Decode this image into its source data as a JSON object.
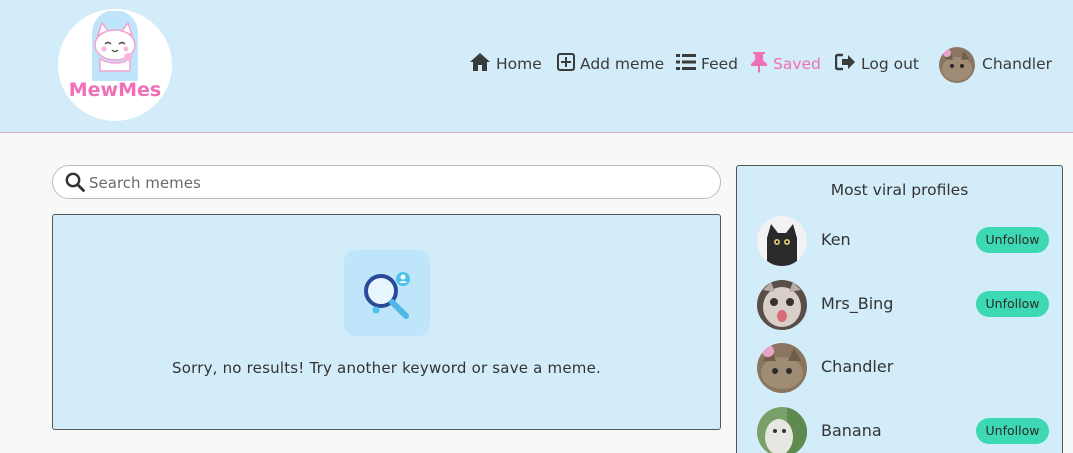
{
  "app": {
    "logo_text": "MewMes"
  },
  "nav": {
    "home": "Home",
    "add_meme": "Add meme",
    "feed": "Feed",
    "saved": "Saved",
    "logout": "Log out",
    "user": "Chandler"
  },
  "search": {
    "placeholder": "Search memes",
    "value": ""
  },
  "results": {
    "empty_message": "Sorry, no results! Try another keyword or save a meme."
  },
  "viral": {
    "title": "Most viral profiles",
    "profiles": [
      {
        "name": "Ken",
        "button": "Unfollow"
      },
      {
        "name": "Mrs_Bing",
        "button": "Unfollow"
      },
      {
        "name": "Chandler",
        "button": ""
      },
      {
        "name": "Banana",
        "button": "Unfollow"
      }
    ]
  },
  "colors": {
    "header_bg": "#d2ecfa",
    "accent_pink": "#f06fb8",
    "button_teal": "#3dd9b4",
    "panel_bg": "#d2ecfa"
  },
  "icons": [
    "home-icon",
    "plus-square-icon",
    "list-icon",
    "pin-icon",
    "logout-icon",
    "search-icon",
    "magnifier-user-icon"
  ]
}
